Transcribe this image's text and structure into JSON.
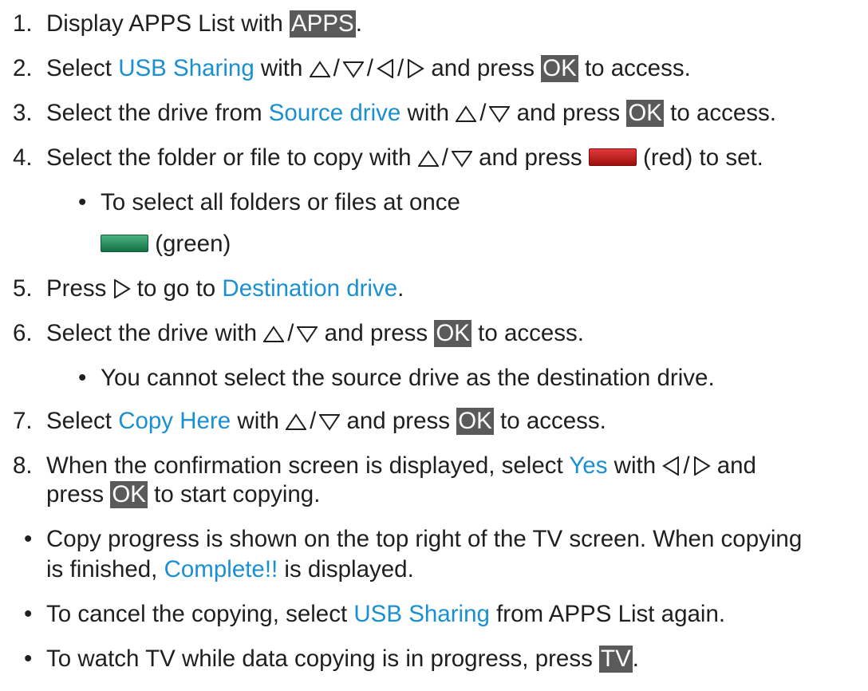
{
  "steps": [
    {
      "num": "1.",
      "a": "Display APPS List with ",
      "key": "APPS",
      "b": "."
    },
    {
      "num": "2.",
      "a": "Select ",
      "link": "USB Sharing",
      "b": " with ",
      "c": " and press ",
      "key": "OK",
      "d": " to access."
    },
    {
      "num": "3.",
      "a": "Select the drive from ",
      "link": "Source drive",
      "b": " with ",
      "c": " and press ",
      "key": "OK",
      "d": " to access."
    },
    {
      "num": "4.",
      "a": "Select the folder or file to copy with ",
      "b": " and press ",
      "c": " (red) to set."
    },
    {
      "num": "5.",
      "a": "Press ",
      "b": " to go to ",
      "link": "Destination drive",
      "c": "."
    },
    {
      "num": "6.",
      "a": "Select the drive with ",
      "b": " and press ",
      "key": "OK",
      "c": " to access."
    },
    {
      "num": "7.",
      "a": "Select ",
      "link": "Copy Here",
      "b": " with ",
      "c": " and press ",
      "key": "OK",
      "d": " to access."
    },
    {
      "num": "8.",
      "a": "When the confirmation screen is displayed, select ",
      "link": "Yes",
      "b": " with ",
      "c": " and",
      "line2a": "press ",
      "key": "OK",
      "line2b": " to start copying."
    }
  ],
  "step4_sub": {
    "bullet": "•",
    "text": "To select all folders or files at once",
    "green": " (green)"
  },
  "step6_sub": {
    "bullet": "•",
    "text": "You cannot select the source drive as the destination drive."
  },
  "slash": "/",
  "notes": [
    {
      "bullet": "•",
      "a": "Copy progress is shown on the top right of the TV screen. When copying",
      "b": "is finished, ",
      "link": "Complete!!",
      "c": " is displayed."
    },
    {
      "bullet": "•",
      "a": "To cancel the copying, select ",
      "link": "USB Sharing",
      "b": " from APPS List again."
    },
    {
      "bullet": "•",
      "a": "To watch TV while data copying is in progress, press ",
      "key": "TV",
      "b": "."
    }
  ],
  "icons": {
    "up": "triangle-up-outline",
    "down": "triangle-down-outline",
    "left": "triangle-left-outline",
    "right": "triangle-right-outline"
  },
  "colors": {
    "text": "#1f1f1f",
    "link": "#1a8fd1",
    "key_bg": "#5a5a5a",
    "red": "#c41e1e",
    "green": "#2b8a5a"
  }
}
